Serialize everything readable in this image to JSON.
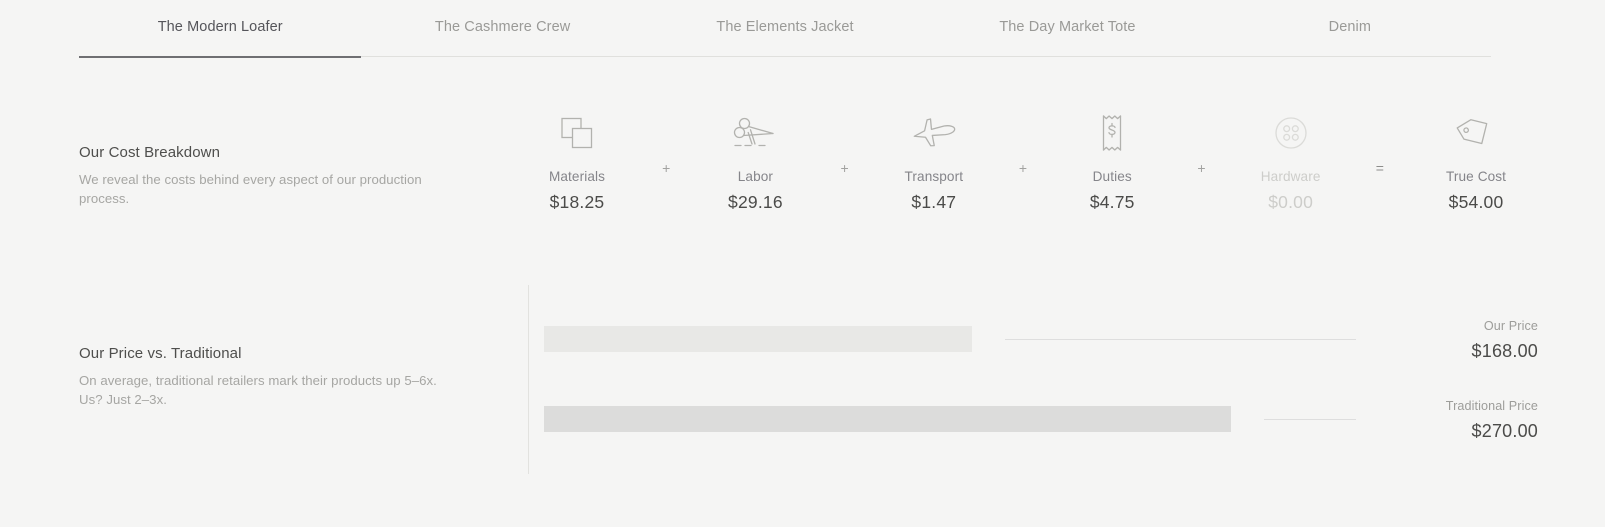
{
  "tabs": [
    {
      "label": "The Modern Loafer",
      "active": true
    },
    {
      "label": "The Cashmere Crew",
      "active": false
    },
    {
      "label": "The Elements Jacket",
      "active": false
    },
    {
      "label": "The Day Market Tote",
      "active": false
    },
    {
      "label": "Denim",
      "active": false
    }
  ],
  "cost_section": {
    "title": "Our Cost Breakdown",
    "description": "We reveal the costs behind every aspect of our production process.",
    "plus": "+",
    "equals": "=",
    "items": [
      {
        "icon": "fabric-swatches-icon",
        "label": "Materials",
        "value": "$18.25",
        "muted": false
      },
      {
        "icon": "scissors-icon",
        "label": "Labor",
        "value": "$29.16",
        "muted": false
      },
      {
        "icon": "airplane-icon",
        "label": "Transport",
        "value": "$1.47",
        "muted": false
      },
      {
        "icon": "receipt-dollar-icon",
        "label": "Duties",
        "value": "$4.75",
        "muted": false
      },
      {
        "icon": "garment-button-icon",
        "label": "Hardware",
        "value": "$0.00",
        "muted": true
      }
    ],
    "total": {
      "icon": "price-tag-icon",
      "label": "True Cost",
      "value": "$54.00"
    }
  },
  "price_section": {
    "title": "Our Price vs. Traditional",
    "description": "On average, traditional retailers mark their products up 5–6x. Us? Just 2–3x.",
    "bars": [
      {
        "name": "Our Price",
        "value": "$168.00"
      },
      {
        "name": "Traditional Price",
        "value": "$270.00"
      }
    ]
  },
  "chart_data": {
    "type": "bar",
    "title": "Our Price vs. Traditional",
    "categories": [
      "Our Price",
      "Traditional Price"
    ],
    "values": [
      168.0,
      270.0
    ],
    "value_labels": [
      "$168.00",
      "$270.00"
    ],
    "xlabel": "",
    "ylabel": "",
    "xlim": [
      0,
      270
    ],
    "grid": false,
    "legend": false,
    "orientation": "horizontal",
    "colors": [
      "#e8e8e6",
      "#dcdcdb"
    ]
  },
  "colors": {
    "background": "#f5f5f4",
    "text": "#4b4b49",
    "muted": "#a6a6a3",
    "disabled": "#cdcdca",
    "rule": "#e0e0dd",
    "bar_ours": "#e8e8e6",
    "bar_traditional": "#dcdcdb",
    "active_underline": "#6f6f72"
  }
}
